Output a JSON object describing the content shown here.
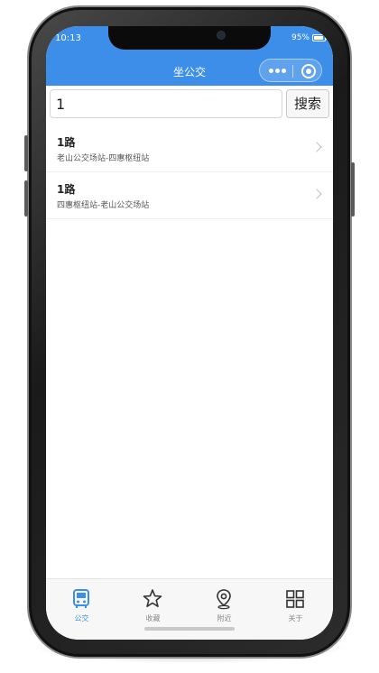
{
  "status_bar": {
    "time": "10:13",
    "battery": "95%"
  },
  "app_title": "坐公交",
  "search": {
    "value": "1",
    "button_label": "搜索"
  },
  "routes": [
    {
      "name": "1路",
      "desc": "老山公交场站-四惠枢纽站"
    },
    {
      "name": "1路",
      "desc": "四惠枢纽站-老山公交场站"
    }
  ],
  "tabs": [
    {
      "label": "公交",
      "icon": "bus-icon",
      "active": true
    },
    {
      "label": "收藏",
      "icon": "star-icon",
      "active": false
    },
    {
      "label": "附近",
      "icon": "location-pin-icon",
      "active": false
    },
    {
      "label": "关于",
      "icon": "grid-icon",
      "active": false
    }
  ],
  "colors": {
    "accent": "#3d8ee8",
    "tab_inactive": "#888888"
  }
}
